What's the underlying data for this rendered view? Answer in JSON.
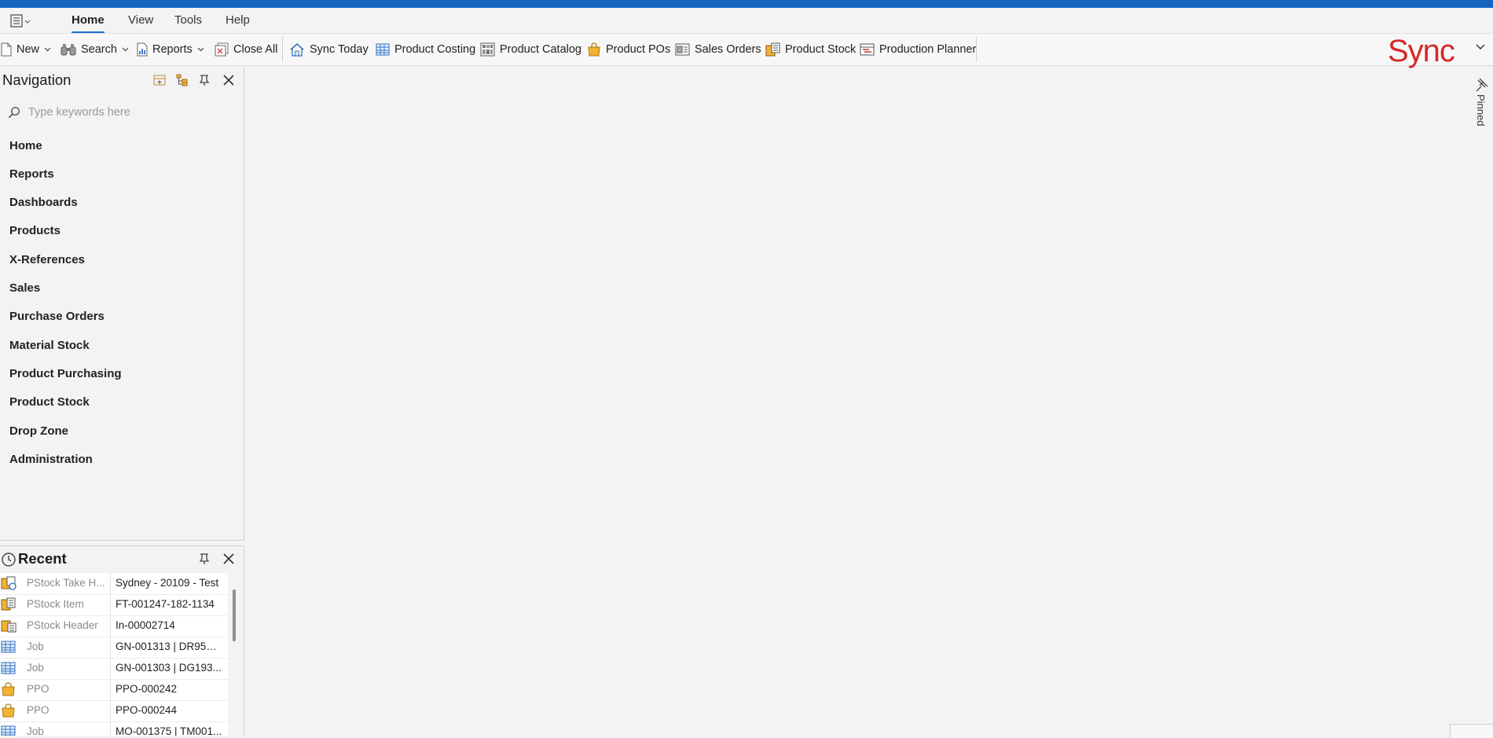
{
  "menu": {
    "tabs": [
      {
        "label": "Home",
        "active": true
      },
      {
        "label": "View",
        "active": false
      },
      {
        "label": "Tools",
        "active": false
      },
      {
        "label": "Help",
        "active": false
      }
    ]
  },
  "toolbar": {
    "new_label": "New",
    "search_label": "Search",
    "reports_label": "Reports",
    "close_all_label": "Close All",
    "shortcuts": [
      {
        "label": "Sync Today",
        "icon": "house-icon"
      },
      {
        "label": "Product Costing",
        "icon": "grid-icon"
      },
      {
        "label": "Product Catalog",
        "icon": "catalog-icon"
      },
      {
        "label": "Product POs",
        "icon": "bag-icon"
      },
      {
        "label": "Sales Orders",
        "icon": "sales-orders-icon"
      },
      {
        "label": "Product Stock",
        "icon": "product-stock-icon"
      },
      {
        "label": "Production Planner",
        "icon": "planner-icon"
      }
    ]
  },
  "brand": {
    "text": "Sync",
    "color": "#d42a2a"
  },
  "navigation": {
    "title": "Navigation",
    "search_placeholder": "Type keywords here",
    "items": [
      "Home",
      "Reports",
      "Dashboards",
      "Products",
      "X-References",
      "Sales",
      "Purchase Orders",
      "Material Stock",
      "Product Purchasing",
      "Product Stock",
      "Drop Zone",
      "Administration"
    ]
  },
  "recent": {
    "title": "Recent",
    "rows": [
      {
        "type": "PStock Take H...",
        "value": "Sydney - 20109 - Test",
        "icon": "stock-take-icon"
      },
      {
        "type": "PStock Item",
        "value": "FT-001247-182-1134",
        "icon": "stock-item-icon"
      },
      {
        "type": "PStock Header",
        "value": "In-00002714",
        "icon": "stock-header-icon"
      },
      {
        "type": "Job",
        "value": "GN-001313 | DR95D ...",
        "icon": "job-icon"
      },
      {
        "type": "Job",
        "value": "GN-001303 | DG193...",
        "icon": "job-icon"
      },
      {
        "type": "PPO",
        "value": "PPO-000242",
        "icon": "bag-icon"
      },
      {
        "type": "PPO",
        "value": "PPO-000244",
        "icon": "bag-icon"
      },
      {
        "type": "Job",
        "value": "MO-001375 | TM001...",
        "icon": "job-icon"
      }
    ]
  },
  "sidebar": {
    "pinned_label": "Pinned"
  },
  "colors": {
    "accent": "#1565c0",
    "tab_underline": "#1e6fd0",
    "brand": "#d42a2a"
  }
}
